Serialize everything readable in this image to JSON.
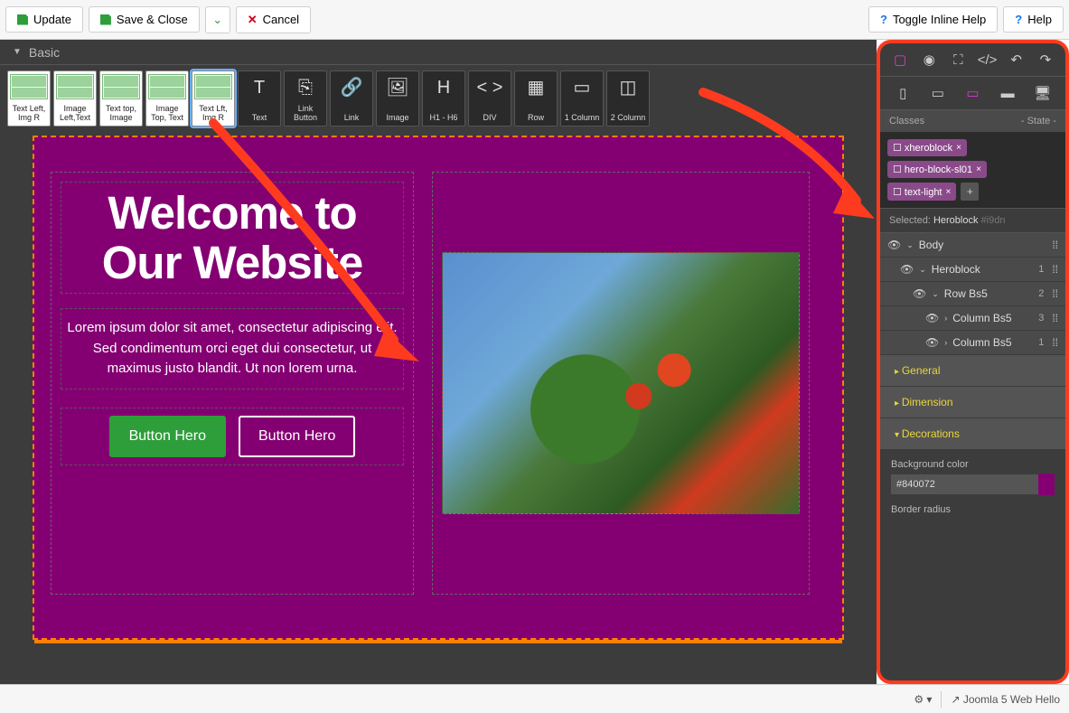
{
  "toolbar": {
    "update": "Update",
    "saveclose": "Save & Close",
    "cancel": "Cancel",
    "toggle_help": "Toggle Inline Help",
    "help": "Help"
  },
  "blocks": {
    "header": "Basic",
    "items": [
      {
        "label": "Text Left, Img R"
      },
      {
        "label": "Image Left,Text"
      },
      {
        "label": "Text top, Image"
      },
      {
        "label": "Image Top, Text"
      },
      {
        "label": "Text Lft, Img R",
        "selected": true
      },
      {
        "label": "Text"
      },
      {
        "label": "Link Button"
      },
      {
        "label": "Link"
      },
      {
        "label": "Image"
      },
      {
        "label": "H1 - H6"
      },
      {
        "label": "DIV"
      },
      {
        "label": "Row"
      },
      {
        "label": "1 Column"
      },
      {
        "label": "2 Column"
      }
    ]
  },
  "hero": {
    "title": "Welcome to Our Website",
    "text": "Lorem ipsum dolor sit amet, consectetur adipiscing elit. Sed condimentum orci eget dui consectetur, ut maximus justo blandit. Ut non lorem urna.",
    "btn1": "Button Hero",
    "btn2": "Button Hero"
  },
  "rp": {
    "classes_label": "Classes",
    "state_label": "- State -",
    "classes": [
      "xheroblock",
      "hero-block-sl01",
      "text-light"
    ],
    "selected_label": "Selected:",
    "selected_value": "Heroblock",
    "selected_id": "#i9dn",
    "tree": [
      {
        "label": "Body",
        "num": "",
        "level": 0,
        "chev": "⌄"
      },
      {
        "label": "Heroblock",
        "num": "1",
        "level": 1,
        "chev": "⌄"
      },
      {
        "label": "Row Bs5",
        "num": "2",
        "level": 2,
        "chev": "⌄"
      },
      {
        "label": "Column Bs5",
        "num": "3",
        "level": 3,
        "chev": "›"
      },
      {
        "label": "Column Bs5",
        "num": "1",
        "level": 3,
        "chev": "›"
      }
    ],
    "accordion": {
      "general": "General",
      "dimension": "Dimension",
      "decorations": "Decorations"
    },
    "bgcolor_label": "Background color",
    "bgcolor_value": "#840072",
    "border_radius_label": "Border radius"
  },
  "bottom": {
    "site": "Joomla 5 Web Hello"
  }
}
